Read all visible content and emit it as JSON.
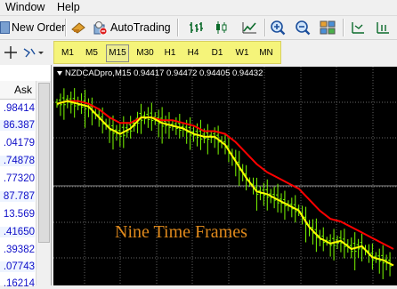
{
  "menu": {
    "items": [
      "Window",
      "Help"
    ]
  },
  "toolbar": {
    "new_order_label": "New Order",
    "autotrading_label": "AutoTrading"
  },
  "timeframes": {
    "items": [
      "M1",
      "M5",
      "M15",
      "M30",
      "H1",
      "H4",
      "D1",
      "W1",
      "MN"
    ],
    "active": "M15"
  },
  "market_watch": {
    "column_ask": "Ask",
    "rows": [
      ".98414",
      "86.387",
      ".04179",
      ".74878",
      ".77320",
      "87.787",
      "13.569",
      ".41650",
      ".39382",
      ".07743",
      ".16214"
    ]
  },
  "chart": {
    "header": "NZDCADpro,M15  0.94417 0.94472 0.94405 0.94432",
    "overlay_text": "Nine Time Frames",
    "colors": {
      "price_bars": "#7cfc00",
      "fast_ma": "#ffff00",
      "slow_ma": "#ff0000",
      "grid": "#888888"
    }
  },
  "chart_data": {
    "type": "line",
    "title": "NZDCADpro,M15",
    "series": [
      {
        "values": [
          0.9441,
          0.9442,
          0.9441,
          0.944,
          0.9436,
          0.9432,
          0.943,
          0.9432,
          0.9436,
          0.9436,
          0.9434,
          0.9433,
          0.9432,
          0.943,
          0.9429,
          0.9429,
          0.9426,
          0.942,
          0.9414,
          0.9409,
          0.9408,
          0.9406,
          0.9404,
          0.9402,
          0.9396,
          0.9392,
          0.939,
          0.9391,
          0.9388,
          0.9389,
          0.9385,
          0.9384,
          0.9382
        ]
      },
      {
        "values": [
          0.9441,
          0.9442,
          0.9442,
          0.9441,
          0.9439,
          0.9436,
          0.9434,
          0.9434,
          0.9436,
          0.9436,
          0.9435,
          0.9435,
          0.9434,
          0.9433,
          0.9431,
          0.9431,
          0.943,
          0.9427,
          0.9423,
          0.9419,
          0.9416,
          0.9414,
          0.9412,
          0.941,
          0.9406,
          0.9402,
          0.9399,
          0.9398,
          0.9396,
          0.9394,
          0.9392,
          0.939,
          0.9388
        ]
      }
    ]
  }
}
